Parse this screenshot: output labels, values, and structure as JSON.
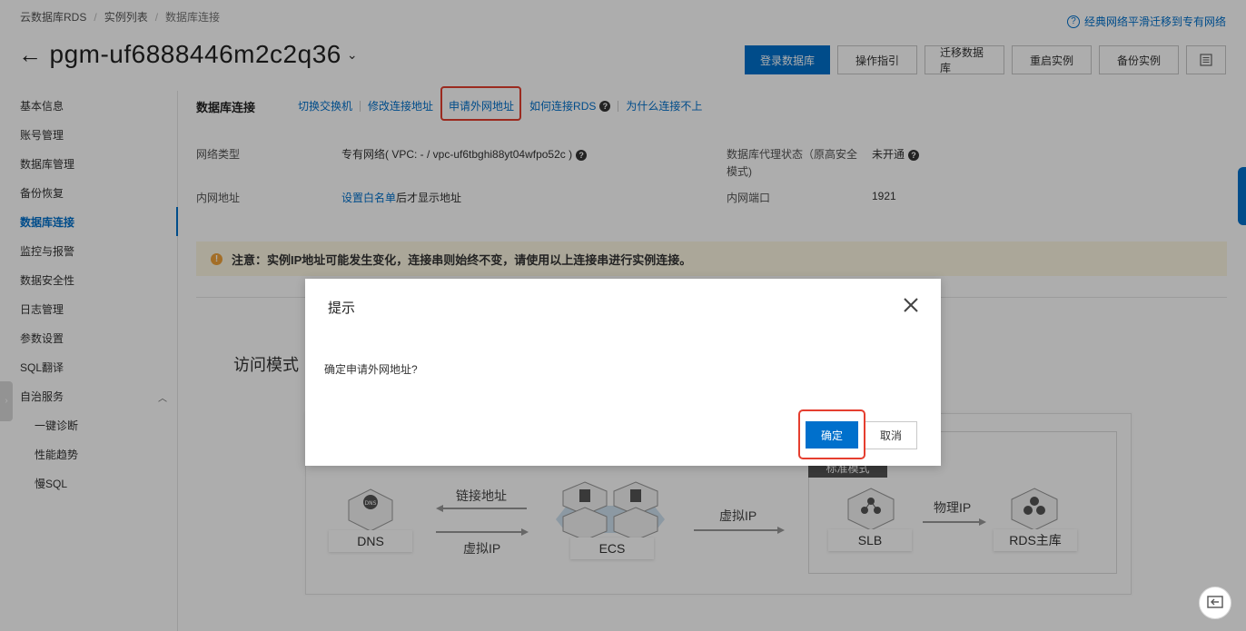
{
  "breadcrumb": [
    "云数据库RDS",
    "实例列表",
    "数据库连接"
  ],
  "top_link": "经典网络平滑迁移到专有网络",
  "instance_title": "pgm-uf6888446m2c2q36",
  "header_buttons": {
    "login": "登录数据库",
    "guide": "操作指引",
    "migrate": "迁移数据库",
    "restart": "重启实例",
    "backup": "备份实例"
  },
  "sidebar": {
    "items": [
      "基本信息",
      "账号管理",
      "数据库管理",
      "备份恢复",
      "数据库连接",
      "监控与报警",
      "数据安全性",
      "日志管理",
      "参数设置",
      "SQL翻译",
      "自治服务"
    ],
    "sub_items": [
      "一键诊断",
      "性能趋势",
      "慢SQL"
    ],
    "active": "数据库连接"
  },
  "section": {
    "title": "数据库连接",
    "actions": [
      "切换交换机",
      "修改连接地址",
      "申请外网地址",
      "如何连接RDS",
      "为什么连接不上"
    ]
  },
  "info": {
    "network_type_label": "网络类型",
    "network_type_value": "专有网络( VPC: - / vpc-uf6tbghi88yt04wfpo52c )",
    "proxy_label_1": "数据库代理状态（原高安全",
    "proxy_label_2": "模式)",
    "proxy_value": "未开通",
    "intranet_label": "内网地址",
    "intranet_link": "设置白名单",
    "intranet_suffix": "后才显示地址",
    "port_label": "内网端口",
    "port_value": "1921"
  },
  "notice": "注意：实例IP地址可能发生变化，连接串则始终不变，请使用以上连接串进行实例连接。",
  "access_title": "访问模式",
  "diagram": {
    "standard_mode": "标准模式",
    "dns": "DNS",
    "ecs": "ECS",
    "slb": "SLB",
    "rds": "RDS主库",
    "link_addr": "链接地址",
    "virtual_ip_bottom": "虚拟IP",
    "virtual_ip": "虚拟IP",
    "physical_ip": "物理IP"
  },
  "modal": {
    "title": "提示",
    "body": "确定申请外网地址?",
    "ok": "确定",
    "cancel": "取消"
  }
}
